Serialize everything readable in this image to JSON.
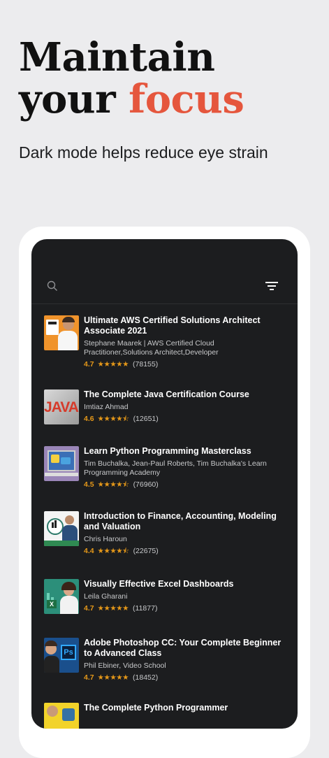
{
  "hero": {
    "line1": "Maintain",
    "line2_word1": "your",
    "line2_accent": "focus",
    "subtitle": "Dark mode helps reduce eye strain",
    "accent_color": "#e5563d"
  },
  "app": {
    "search_icon": "search-icon",
    "filter_icon": "filter-icon"
  },
  "courses": [
    {
      "title": "Ultimate AWS Certified Solutions Architect Associate 2021",
      "instructor": "Stephane Maarek | AWS Certified Cloud Practitioner,Solutions Architect,Developer",
      "rating": "4.7",
      "stars": "★★★★★",
      "reviews": "(78155)"
    },
    {
      "title": "The Complete Java Certification Course",
      "instructor": "Imtiaz Ahmad",
      "rating": "4.6",
      "stars": "★★★★⯪",
      "reviews": "(12651)"
    },
    {
      "title": "Learn Python Programming Masterclass",
      "instructor": "Tim Buchalka, Jean-Paul Roberts, Tim Buchalka's Learn Programming Academy",
      "rating": "4.5",
      "stars": "★★★★⯪",
      "reviews": "(76960)"
    },
    {
      "title": "Introduction to Finance, Accounting, Modeling and Valuation",
      "instructor": "Chris Haroun",
      "rating": "4.4",
      "stars": "★★★★⯪",
      "reviews": "(22675)"
    },
    {
      "title": "Visually Effective Excel Dashboards",
      "instructor": "Leila Gharani",
      "rating": "4.7",
      "stars": "★★★★★",
      "reviews": "(11877)"
    },
    {
      "title": "Adobe Photoshop CC: Your Complete Beginner to Advanced Class",
      "instructor": "Phil Ebiner, Video School",
      "rating": "4.7",
      "stars": "★★★★★",
      "reviews": "(18452)"
    },
    {
      "title": "The Complete Python Programmer",
      "instructor": "",
      "rating": "",
      "stars": "",
      "reviews": ""
    }
  ]
}
